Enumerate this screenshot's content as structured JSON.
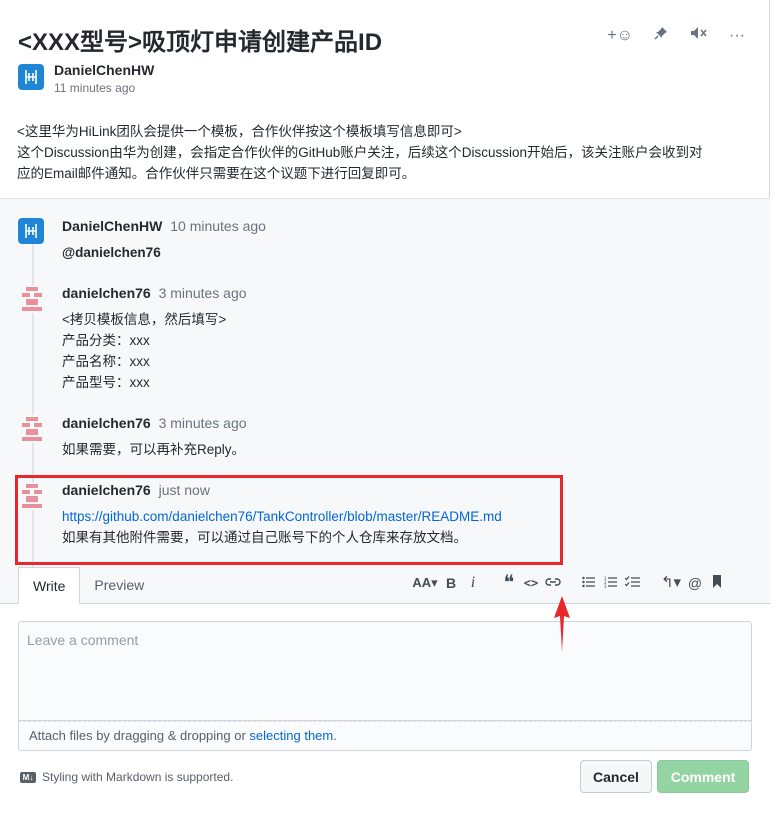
{
  "discussion": {
    "title": "<XXX型号>吸顶灯申请创建产品ID",
    "author": "DanielChenHW",
    "time": "11 minutes ago",
    "body": [
      "<这里华为HiLink团队会提供一个模板，合作伙伴按这个模板填写信息即可>",
      "这个Discussion由华为创建，会指定合作伙伴的GitHub账户关注，后续这个Discussion开始后，该关注账户会收到对",
      "应的Email邮件通知。合作伙伴只需要在这个议题下进行回复即可。"
    ],
    "header_icons": [
      "add-reaction-icon",
      "pin-icon",
      "mute-icon",
      "more-icon"
    ]
  },
  "comments": [
    {
      "author": "DanielChenHW",
      "time": "10 minutes ago",
      "lines": [
        "@danielchen76"
      ],
      "avatar": "huawei-logo"
    },
    {
      "author": "danielchen76",
      "time": "3 minutes ago",
      "lines": [
        "<拷贝模板信息，然后填写>",
        "产品分类：xxx",
        "产品名称：xxx",
        "产品型号：xxx"
      ],
      "avatar": "identicon"
    },
    {
      "author": "danielchen76",
      "time": "3 minutes ago",
      "lines": [
        "如果需要，可以再补充Reply。"
      ],
      "avatar": "identicon"
    },
    {
      "author": "danielchen76",
      "time": "just now",
      "link": "https://github.com/danielchen76/TankController/blob/master/README.md",
      "lines": [
        "如果有其他附件需要，可以通过自己账号下的个人仓库来存放文档。"
      ],
      "avatar": "identicon"
    }
  ],
  "editor": {
    "tabs": [
      "Write",
      "Preview"
    ],
    "active_tab": "Write",
    "placeholder": "Leave a comment",
    "attach_text": "Attach files by dragging & dropping or ",
    "attach_link": "selecting them",
    "attach_suffix": ".",
    "markdown_note": "Styling with Markdown is supported.",
    "markdown_badge": "M↓",
    "cancel_label": "Cancel",
    "comment_label": "Comment",
    "toolbar": {
      "heading": "AA▾",
      "bold": "B",
      "italic": "i",
      "quote": "❝",
      "code": "<>",
      "link": "🔗",
      "ul": "☰",
      "ol": "☷",
      "task": "☑",
      "reply": "↰▾",
      "mention": "@",
      "bookmark": "▮"
    }
  },
  "colors": {
    "link": "#0366d6",
    "highlight_border": "#e8262b",
    "comment_button": "#94d3a2",
    "huawei_logo": "#1f86d6"
  }
}
